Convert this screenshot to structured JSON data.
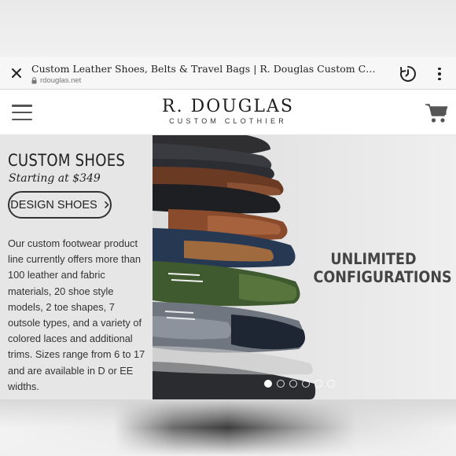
{
  "browser": {
    "page_title": "Custom Leather Shoes, Belts & Travel Bags | R. Douglas Custom Clothier",
    "url": "rdouglas.net",
    "icons": {
      "close": "close-icon",
      "lock": "lock-icon",
      "history": "history-icon",
      "more": "more-vert-icon"
    }
  },
  "header": {
    "logo_name": "R. DOUGLAS",
    "logo_sub": "CUSTOM CLOTHIER",
    "icons": {
      "menu": "hamburger-icon",
      "cart": "cart-icon"
    }
  },
  "hero": {
    "heading": "CUSTOM SHOES",
    "price_text": "Starting at $349",
    "button_label": "DESIGN SHOES",
    "description": "Our custom footwear product line currently offers more than 100 leather and fabric materials, 20 shoe style models, 2 toe shapes, 7 outsole types, and a variety of colored laces and additional trims. Sizes range from 6 to 17 and are available in D or EE widths.",
    "overlay_line1": "UNLIMITED",
    "overlay_line2": "CONFIGURATIONS",
    "carousel": {
      "slide_count": 6,
      "active_index": 0
    }
  },
  "colors": {
    "accent_dark": "#222222",
    "panel_bg": "#e6e6e6",
    "header_bg": "#ffffff"
  }
}
